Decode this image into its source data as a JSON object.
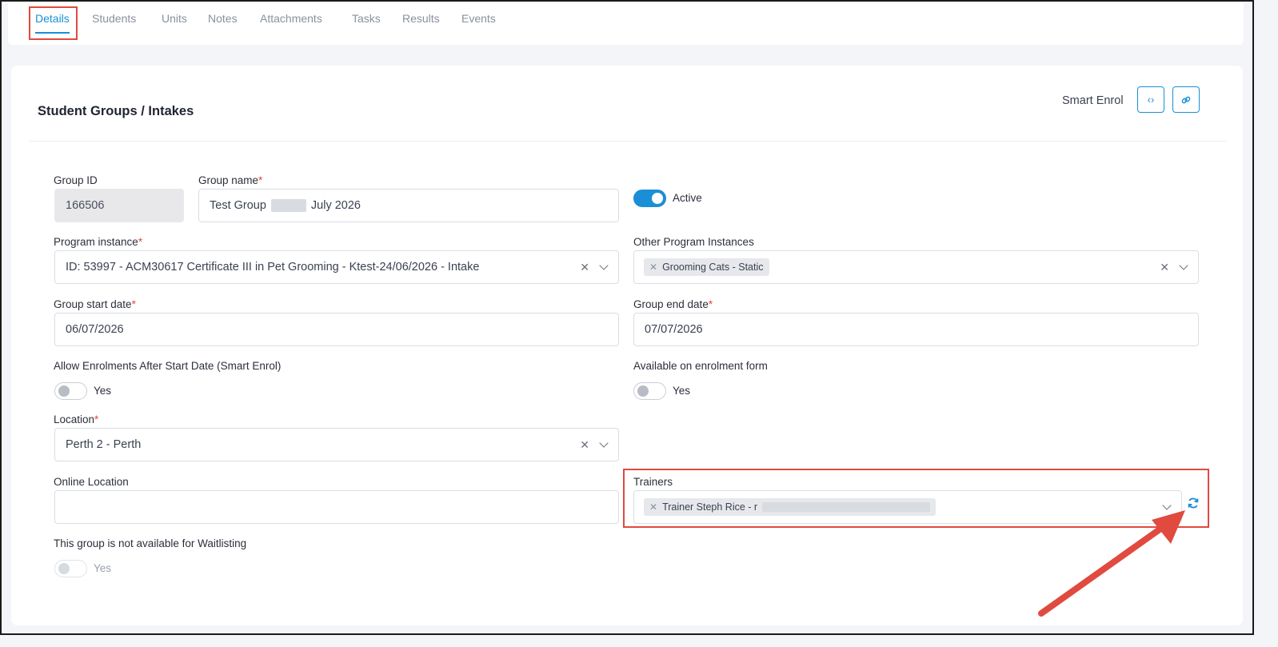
{
  "tabs": [
    {
      "label": "Details",
      "active": true
    },
    {
      "label": "Students"
    },
    {
      "label": "Units"
    },
    {
      "label": "Notes"
    },
    {
      "label": "Attachments"
    },
    {
      "label": "Tasks"
    },
    {
      "label": "Results"
    },
    {
      "label": "Events"
    }
  ],
  "card": {
    "title": "Student Groups / Intakes",
    "smart_enrol_label": "Smart Enrol",
    "embed_icon": "code-icon",
    "link_icon": "link-icon"
  },
  "form": {
    "group_id": {
      "label": "Group ID",
      "value": "166506"
    },
    "group_name": {
      "label": "Group name",
      "required": "*",
      "value_prefix": "Test Group",
      "value_suffix": "July 2026"
    },
    "active": {
      "label": "Active",
      "on": true
    },
    "program_instance": {
      "label": "Program instance",
      "required": "*",
      "value": "ID: 53997 - ACM30617 Certificate III in Pet Grooming - Ktest-24/06/2026 - Intake"
    },
    "other_program_instances": {
      "label": "Other Program Instances",
      "chips": [
        "Grooming Cats - Static"
      ]
    },
    "group_start_date": {
      "label": "Group start date",
      "required": "*",
      "value": "06/07/2026"
    },
    "group_end_date": {
      "label": "Group end date",
      "required": "*",
      "value": "07/07/2026"
    },
    "allow_enrolments": {
      "label": "Allow Enrolments After Start Date (Smart Enrol)",
      "toggle_label": "Yes",
      "on": false
    },
    "available_on_form": {
      "label": "Available on enrolment form",
      "toggle_label": "Yes",
      "on": false
    },
    "location": {
      "label": "Location",
      "required": "*",
      "value": "Perth 2 - Perth"
    },
    "online_location": {
      "label": "Online Location",
      "value": ""
    },
    "trainers": {
      "label": "Trainers",
      "chip": "Trainer Steph Rice - r"
    },
    "waitlisting": {
      "label": "This group is not available for Waitlisting",
      "toggle_label": "Yes",
      "on": false
    }
  },
  "colors": {
    "accent": "#1a8fd6",
    "highlight": "#e04a3f"
  }
}
